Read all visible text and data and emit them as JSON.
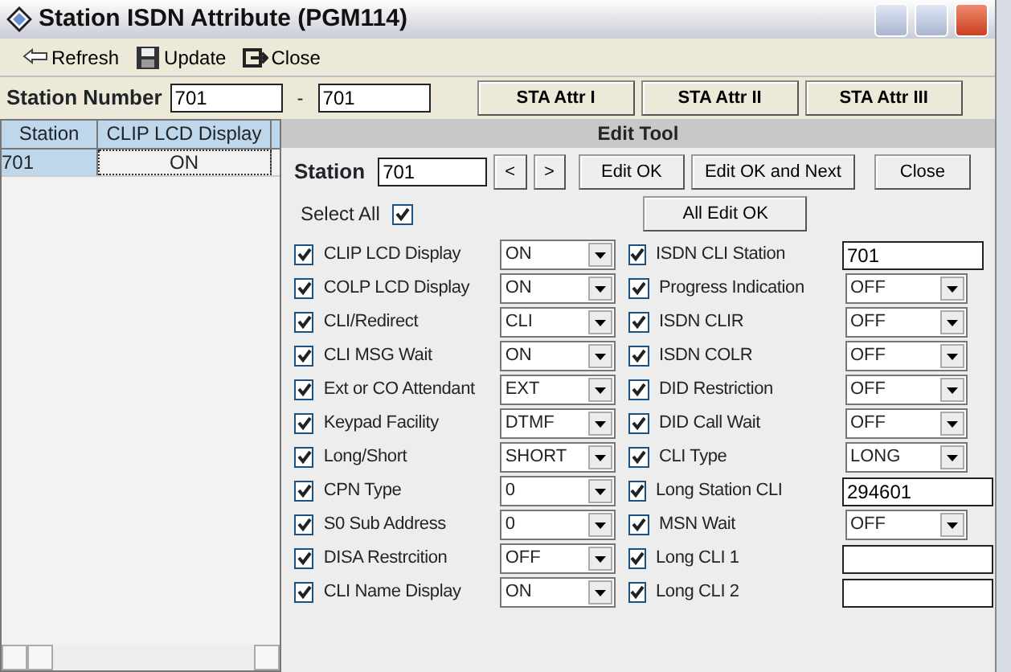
{
  "window": {
    "title": "Station ISDN Attribute (PGM114)"
  },
  "toolbar": [
    {
      "label": "Refresh"
    },
    {
      "label": "Update"
    },
    {
      "label": "Close"
    }
  ],
  "station_number": {
    "label": "Station Number",
    "from": "701",
    "separator": "-",
    "to": "701"
  },
  "attr_buttons": [
    "STA Attr I",
    "STA Attr II",
    "STA Attr III"
  ],
  "grid": {
    "columns": [
      "Station",
      "CLIP LCD Display"
    ],
    "rows": [
      [
        "701",
        "ON"
      ]
    ]
  },
  "edit_tool": {
    "title": "Edit Tool",
    "station_label": "Station",
    "station": "701",
    "buttons": [
      "<",
      ">",
      "Edit OK",
      "Edit OK and Next",
      "Close",
      "All Edit OK"
    ],
    "select_all": {
      "label": "Select All",
      "checked": true
    },
    "left": [
      {
        "label": "CLIP LCD Display",
        "kind": "select",
        "value": "ON",
        "checked": true
      },
      {
        "label": "COLP LCD Display",
        "kind": "select",
        "value": "ON",
        "checked": true
      },
      {
        "label": "CLI/Redirect",
        "kind": "select",
        "value": "CLI",
        "checked": true
      },
      {
        "label": "CLI MSG Wait",
        "kind": "select",
        "value": "ON",
        "checked": true
      },
      {
        "label": "Ext or CO Attendant",
        "kind": "select",
        "value": "EXT",
        "checked": true
      },
      {
        "label": "Keypad Facility",
        "kind": "select",
        "value": "DTMF",
        "checked": true
      },
      {
        "label": "Long/Short",
        "kind": "select",
        "value": "SHORT",
        "checked": true
      },
      {
        "label": "CPN Type",
        "kind": "select",
        "value": "0",
        "checked": true
      },
      {
        "label": "S0 Sub Address",
        "kind": "select",
        "value": "0",
        "checked": true
      },
      {
        "label": "DISA Restrcition",
        "kind": "select",
        "value": "OFF",
        "checked": true
      },
      {
        "label": "CLI Name Display",
        "kind": "select",
        "value": "ON",
        "checked": true
      }
    ],
    "right": [
      {
        "label": "ISDN CLI Station",
        "kind": "text",
        "value": "701",
        "checked": true
      },
      {
        "label": "Progress Indication",
        "kind": "select",
        "value": "OFF",
        "checked": true
      },
      {
        "label": "ISDN CLIR",
        "kind": "select",
        "value": "OFF",
        "checked": true
      },
      {
        "label": "ISDN COLR",
        "kind": "select",
        "value": "OFF",
        "checked": true
      },
      {
        "label": "DID Restriction",
        "kind": "select",
        "value": "OFF",
        "checked": true
      },
      {
        "label": "DID Call Wait",
        "kind": "select",
        "value": "OFF",
        "checked": true
      },
      {
        "label": "CLI Type",
        "kind": "select",
        "value": "LONG",
        "checked": true
      },
      {
        "label": "Long Station CLI",
        "kind": "wide",
        "value": "294601",
        "checked": true
      },
      {
        "label": "MSN Wait",
        "kind": "select",
        "value": "OFF",
        "checked": true
      },
      {
        "label": "Long CLI 1",
        "kind": "wide",
        "checked": true
      },
      {
        "label": "Long CLI 2",
        "kind": "wide",
        "checked": true
      }
    ]
  }
}
